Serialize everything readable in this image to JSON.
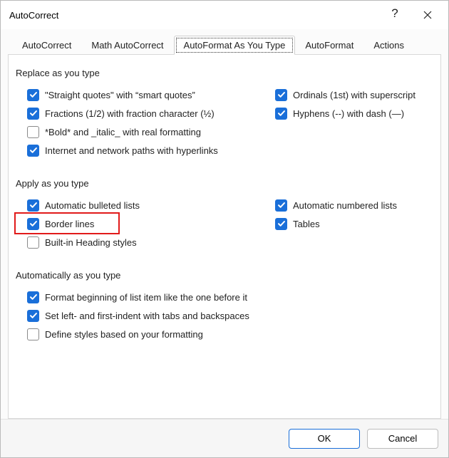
{
  "window": {
    "title": "AutoCorrect"
  },
  "tabs": {
    "autocorrect": "AutoCorrect",
    "math": "Math AutoCorrect",
    "autoformat_type": "AutoFormat As You Type",
    "autoformat": "AutoFormat",
    "actions": "Actions"
  },
  "groups": {
    "replace": {
      "title": "Replace as you type",
      "straight_quotes": "\"Straight quotes\" with “smart quotes”",
      "fractions": "Fractions (1/2) with fraction character (½)",
      "bold_italic": "*Bold* and _italic_ with real formatting",
      "internet_paths": "Internet and network paths with hyperlinks",
      "ordinals": "Ordinals (1st) with superscript",
      "hyphens": "Hyphens (--) with dash (—)"
    },
    "apply": {
      "title": "Apply as you type",
      "bulleted": "Automatic bulleted lists",
      "border": "Border lines",
      "heading": "Built-in Heading styles",
      "numbered": "Automatic numbered lists",
      "tables": "Tables"
    },
    "auto": {
      "title": "Automatically as you type",
      "format_beginning": "Format beginning of list item like the one before it",
      "set_indent": "Set left- and first-indent with tabs and backspaces",
      "define_styles": "Define styles based on your formatting"
    }
  },
  "footer": {
    "ok": "OK",
    "cancel": "Cancel"
  },
  "checked": {
    "straight_quotes": true,
    "fractions": true,
    "bold_italic": false,
    "internet_paths": true,
    "ordinals": true,
    "hyphens": true,
    "bulleted": true,
    "border": true,
    "heading": false,
    "numbered": true,
    "tables": true,
    "format_beginning": true,
    "set_indent": true,
    "define_styles": false
  }
}
